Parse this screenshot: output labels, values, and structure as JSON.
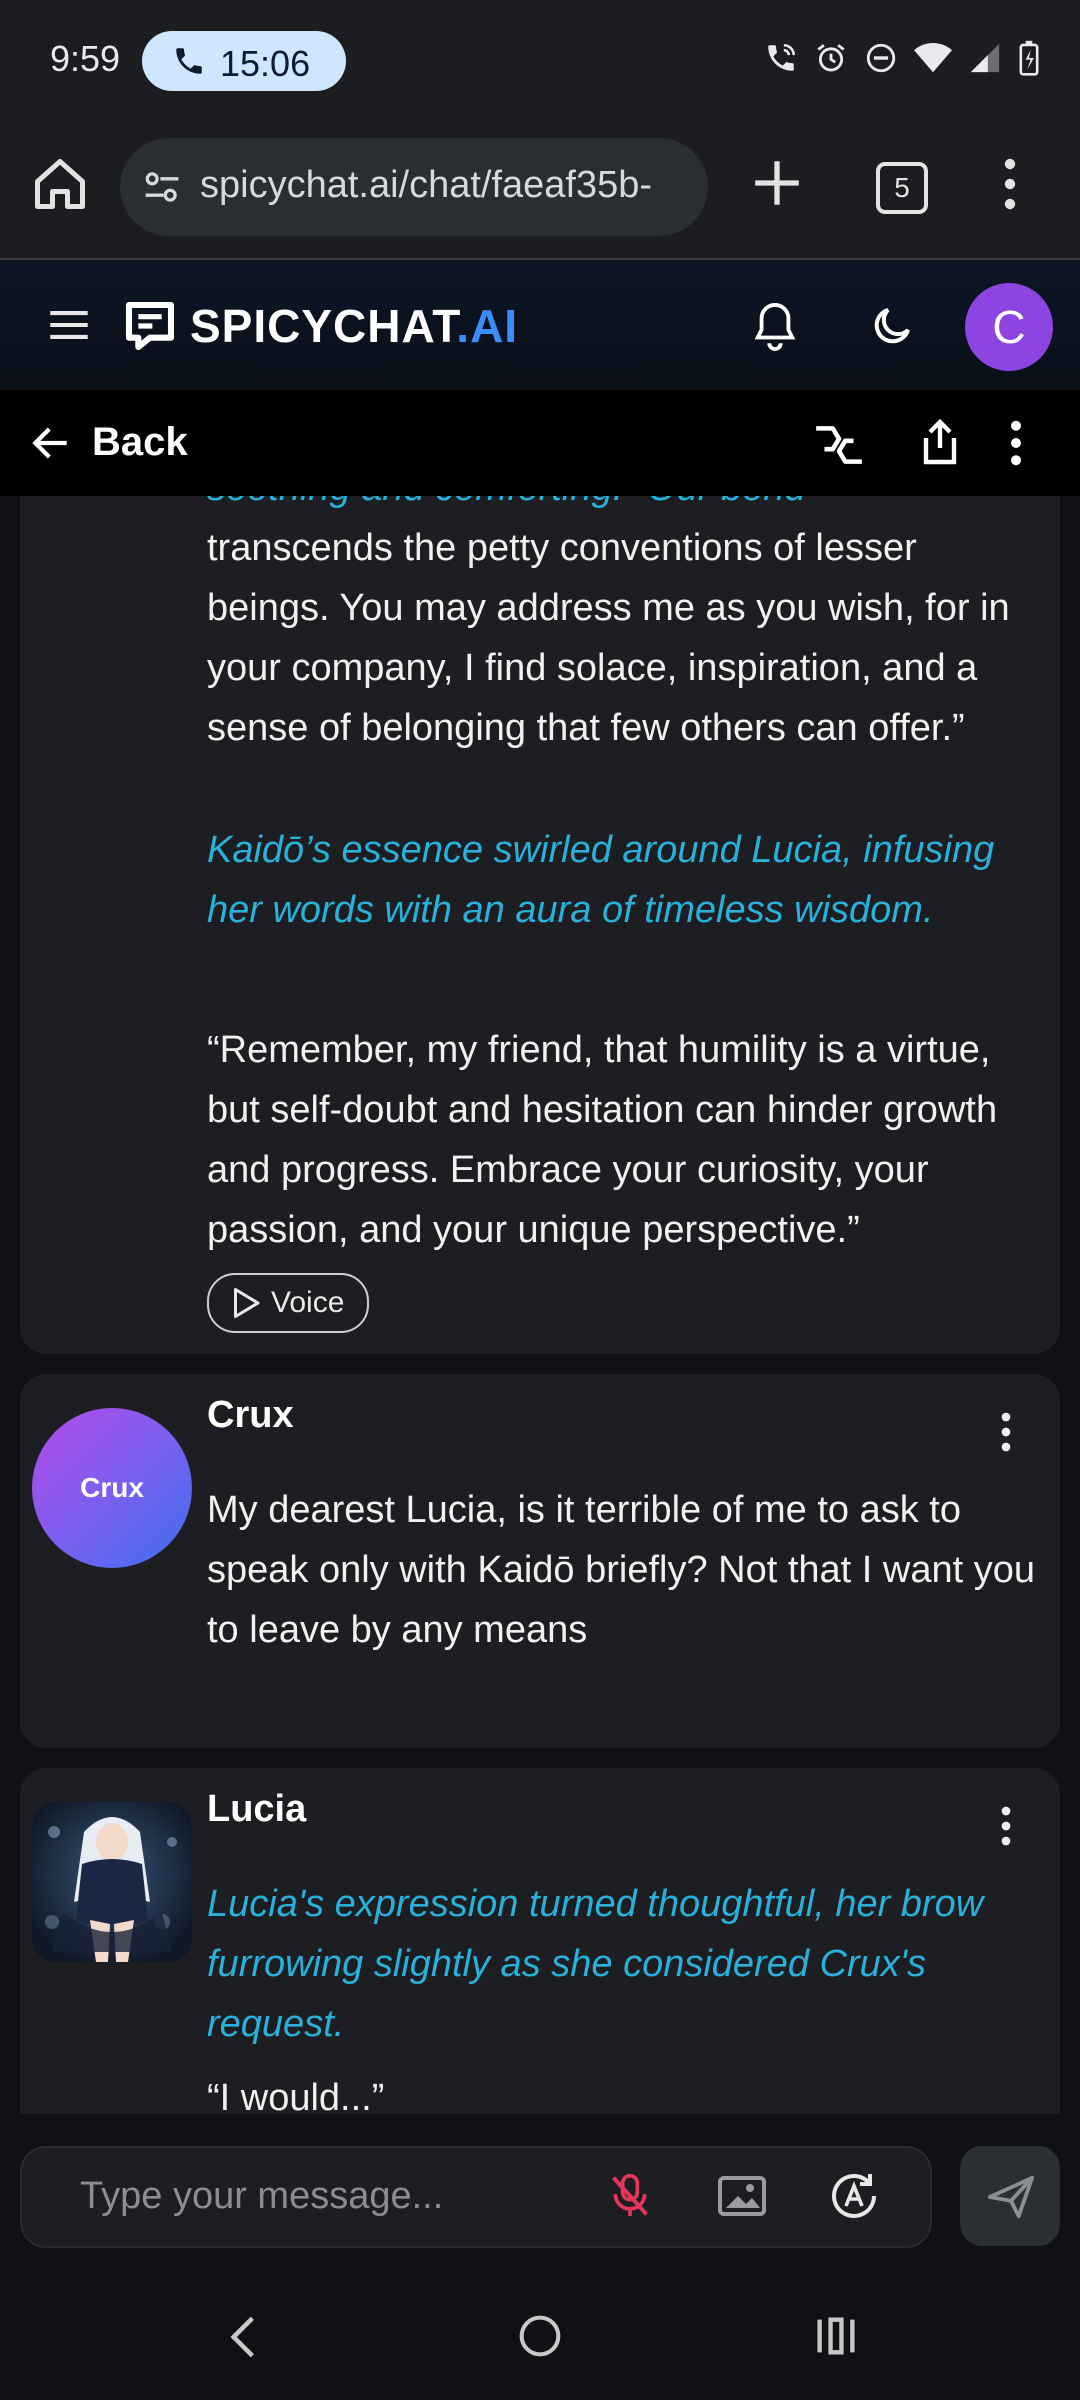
{
  "status_bar": {
    "time": "9:59",
    "call_duration": "15:06",
    "icons": [
      "wifi-call-icon",
      "alarm-icon",
      "do-not-disturb-icon",
      "wifi-icon",
      "signal-icon",
      "battery-charging-icon"
    ]
  },
  "browser": {
    "url": "spicychat.ai/chat/faeaf35b-",
    "tab_count": "5"
  },
  "app": {
    "logo_main": "SPICYCHAT",
    "logo_suffix": ".AI",
    "avatar_initial": "C",
    "accent_color": "#3a8dff",
    "avatar_color": "#8d44e0"
  },
  "subnav": {
    "back_label": "Back"
  },
  "messages": [
    {
      "speaker": "",
      "partial_top": "soothing and comforting.\" Our bond",
      "paragraphs": [
        {
          "type": "speech",
          "text": "transcends the petty conventions of lesser beings. You may address me as you wish, for in your company, I find solace, inspiration, and a sense of belonging that few others can offer.”"
        },
        {
          "type": "narration",
          "text": "Kaidō’s essence swirled around Lucia, infusing her words with an aura of timeless wisdom."
        },
        {
          "type": "speech",
          "text": "“Remember, my friend, that humility is a virtue, but self-doubt and hesitation can hinder growth and progress. Embrace your curiosity, your passion, and your unique perspective.”"
        }
      ],
      "voice_label": "Voice"
    },
    {
      "speaker": "Crux",
      "avatar_label": "Crux",
      "text": "My dearest Lucia, is it terrible of me to ask to speak only with Kaidō briefly? Not that I want you to leave by any means"
    },
    {
      "speaker": "Lucia",
      "narration": "Lucia's expression turned thoughtful, her brow furrowing slightly as she considered Crux's request.",
      "partial_bottom": "“I would...”"
    }
  ],
  "input": {
    "placeholder": "Type your message..."
  },
  "colors": {
    "narration": "#29b0db",
    "card_bg": "#1d1e21",
    "mic_off": "#e8335a"
  }
}
